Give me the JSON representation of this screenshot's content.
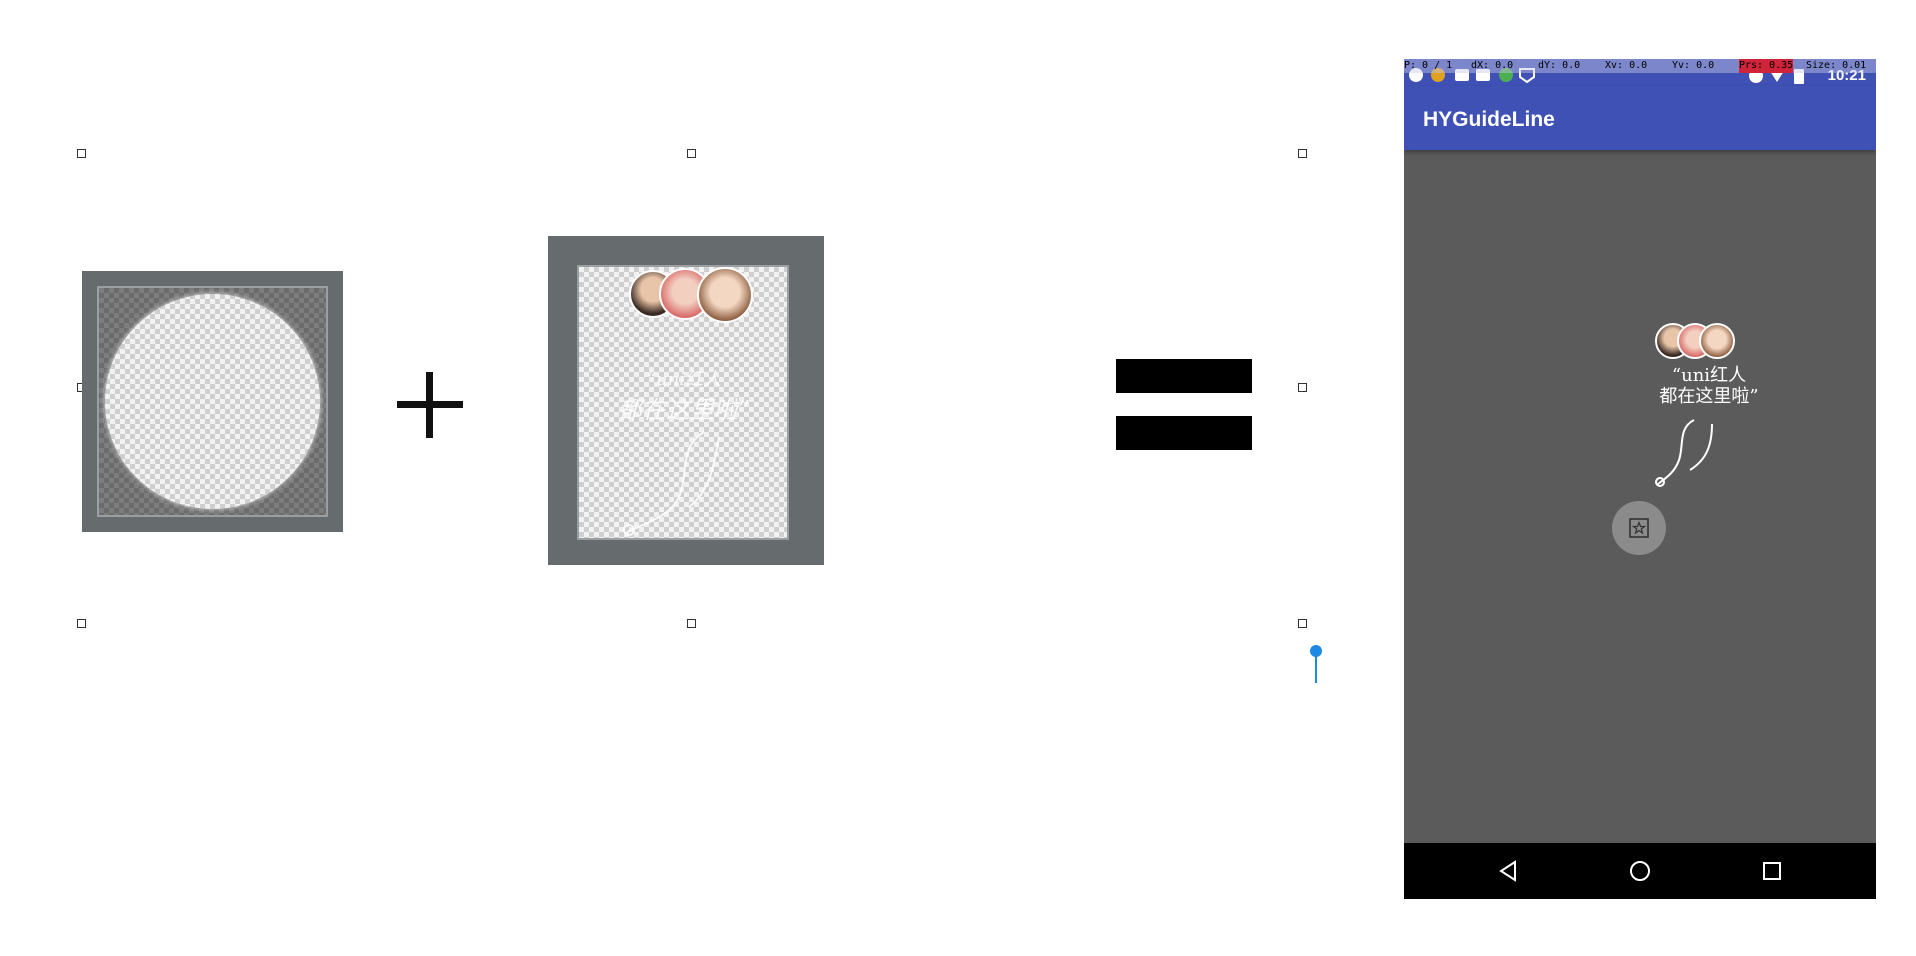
{
  "canvas": {
    "handles": [
      "selection-handle",
      "selection-handle",
      "selection-handle",
      "selection-handle",
      "selection-handle",
      "selection-handle",
      "selection-handle",
      "selection-handle"
    ]
  },
  "formula": {
    "operand_1": "circular-mask-image",
    "operator_1": "+",
    "operand_2": "guide-overlay-image",
    "operator_2": "="
  },
  "guide_image": {
    "caption_line1": "“uni红人",
    "caption_line2": "都在这里啦”"
  },
  "phone": {
    "debug": {
      "p": "P: 0 / 1",
      "dx": "dX: 0.0",
      "dy": "dY: 0.0",
      "xv": "Xv: 0.0",
      "yv": "Yv: 0.0",
      "prs": "Prs: 0.35",
      "size": "Size: 0.01"
    },
    "status_time": "10:21",
    "app_title": "HYGuideLine",
    "guide_caption_line1": "“uni红人",
    "guide_caption_line2": "都在这里啦”",
    "fab_icon": "star-box-icon",
    "nav": [
      "back-icon",
      "home-icon",
      "recents-icon"
    ]
  },
  "colors": {
    "app_bar": "#3f51b5",
    "content_bg": "#5b5b5b",
    "frame_gray": "#666b6d",
    "pin_blue": "#1e88e5"
  }
}
